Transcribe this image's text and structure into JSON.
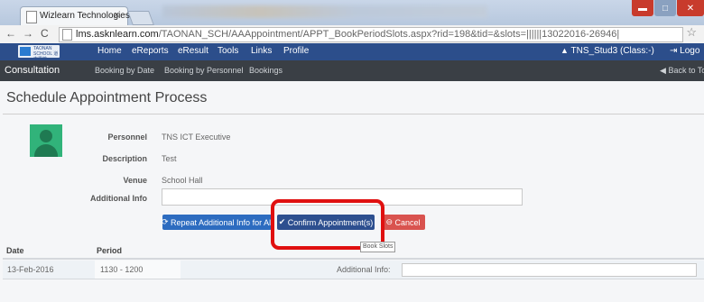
{
  "browser": {
    "tab_title": "Wizlearn Technologies Ltd",
    "tab_close": "×",
    "url_domain": "lms.asknlearn.com",
    "url_path": "/TAONAN_SCH/AAAppointment/APPT_BookPeriodSlots.aspx?rid=198&tid=&slots=||||||13022016-26946|"
  },
  "site_nav": {
    "logo_text": "TAONAN SCHOOL 道南學校",
    "items": [
      "Home",
      "eReports",
      "eResult",
      "Tools",
      "Links",
      "Profile"
    ],
    "user": "TNS_Stud3 (Class:-)",
    "logout": "Logo"
  },
  "sub_nav": {
    "title": "Consultation",
    "items": [
      "Booking by Date",
      "Booking by Personnel",
      "Bookings"
    ],
    "back": "Back to To"
  },
  "page": {
    "title": "Schedule Appointment Process",
    "fields": {
      "personnel_label": "Personnel",
      "personnel_value": "TNS ICT Executive",
      "description_label": "Description",
      "description_value": "Test",
      "venue_label": "Venue",
      "venue_value": "School Hall",
      "additional_info_label": "Additional Info",
      "additional_info_value": ""
    },
    "buttons": {
      "repeat": "Repeat Additional Info for All",
      "confirm": "Confirm Appointment(s)",
      "cancel": "Cancel"
    },
    "tooltip": "Book Slots"
  },
  "table": {
    "headers": [
      "Date",
      "Period"
    ],
    "rows": [
      {
        "date": "13-Feb-2016",
        "period": "1130 - 1200",
        "info_label": "Additional Info:",
        "info_value": ""
      }
    ]
  },
  "colors": {
    "site_nav": "#2c4e8b",
    "sub_nav": "#3a3f45",
    "primary_button": "#2d6cc0",
    "confirm_button": "#2d4f8f",
    "cancel_button": "#d9534f",
    "highlight": "#e01010"
  }
}
